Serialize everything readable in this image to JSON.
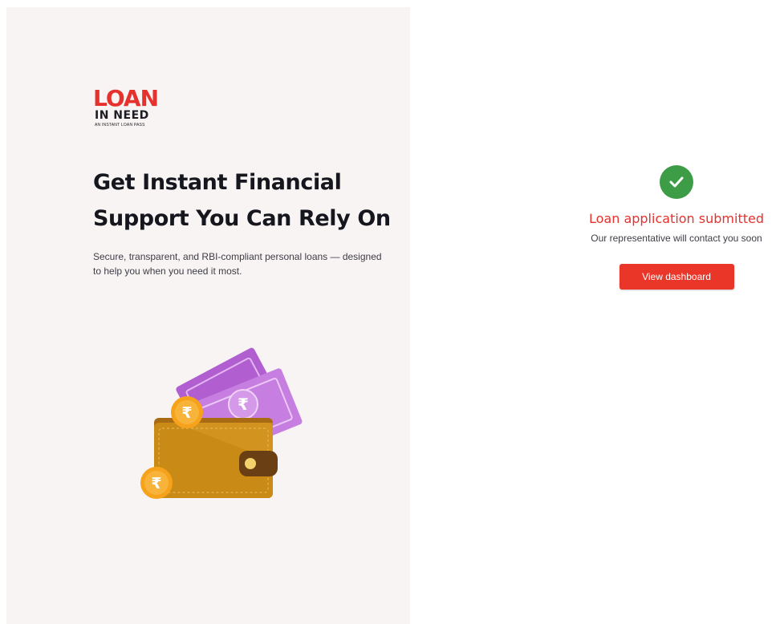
{
  "brand": {
    "logo_word": "LOAN",
    "logo_subword": "IN NEED",
    "logo_tagline": "AN INSTANT LOAN PASS"
  },
  "hero": {
    "headline_line1": "Get Instant Financial",
    "headline_line2": "Support You Can Rely On",
    "subtext": "Secure, transparent, and RBI-compliant personal loans — designed to help you when you need it most."
  },
  "illustration": {
    "icon": "wallet-with-rupee-notes-and-coins",
    "currency_symbol": "₹"
  },
  "status": {
    "icon": "check-circle-icon",
    "title": "Loan application submitted",
    "message": "Our representative will contact you soon",
    "button_label": "View dashboard"
  },
  "colors": {
    "brand_red": "#e6312d",
    "success_green": "#3d9c46",
    "panel_bg": "#f8f4f3",
    "note_purple": "#c67ee0",
    "coin_orange": "#f6a21b",
    "wallet_brown": "#c98b16"
  }
}
